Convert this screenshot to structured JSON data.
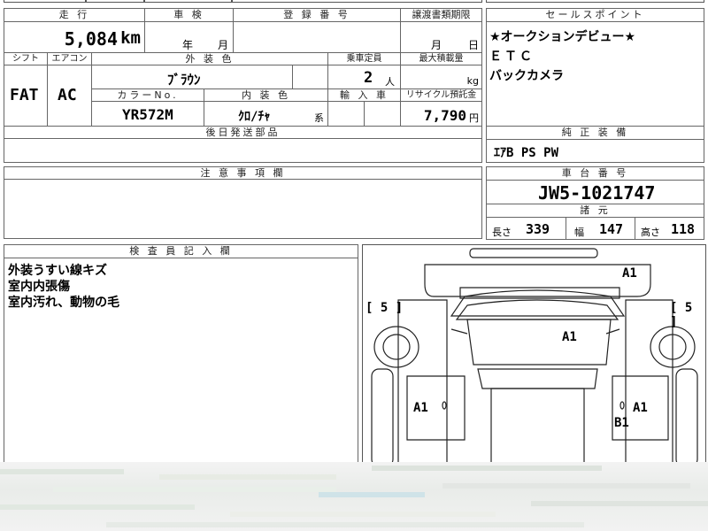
{
  "mileage": {
    "header": "走 行",
    "value": "5,084",
    "unit": "km"
  },
  "inspection": {
    "header": "車 検",
    "year_label": "年",
    "month_label": "月"
  },
  "registration": {
    "header": "登 録 番 号",
    "value": ""
  },
  "transfer_deadline": {
    "header": "譲渡書類期限",
    "month_label": "月",
    "day_label": "日"
  },
  "sales_points": {
    "header": "セールスポイント",
    "items": [
      "★オークションデビュー★",
      "ＥＴＣ",
      "バックカメラ"
    ]
  },
  "shift": {
    "header": "シフト",
    "value": "FAT"
  },
  "aircon": {
    "header": "エアコン",
    "value": "AC"
  },
  "exterior_color": {
    "header": "外 装 色",
    "value": "ﾌﾞﾗｳﾝ"
  },
  "capacity": {
    "header": "乗車定員",
    "value": "2",
    "unit": "人"
  },
  "max_load": {
    "header": "最大積載量",
    "value": "",
    "unit": "kg"
  },
  "color_no": {
    "header": "カラーNo.",
    "value": "YR572M"
  },
  "interior_color": {
    "header": "内 装 色",
    "value": "ｸﾛ/ﾁｬ",
    "suffix": "系"
  },
  "import": {
    "header": "輸 入 車",
    "value": ""
  },
  "recycle_fee": {
    "header": "リサイクル預託金",
    "value": "7,790",
    "unit": "円"
  },
  "later_shipping": {
    "header": "後日発送部品",
    "value": ""
  },
  "factory_equipment": {
    "header": "純 正 装 備",
    "value": "ｴｱB PS PW"
  },
  "notes": {
    "header": "注 意 事 項 欄",
    "value": ""
  },
  "chassis_no": {
    "header": "車 台 番 号",
    "value": "JW5-1021747"
  },
  "dimensions": {
    "header": "諸 元",
    "length_label": "長さ",
    "length": "339",
    "width_label": "幅",
    "width": "147",
    "height_label": "高さ",
    "height": "118"
  },
  "inspector_notes": {
    "header": "検 査 員 記 入 欄",
    "lines": [
      "外装うすい線キズ",
      "室内内張傷",
      "室内汚れ、動物の毛"
    ]
  },
  "diagram": {
    "tire_left": "[ 5 ]",
    "tire_right": "[ 5 ]",
    "marks": [
      "A1",
      "A1",
      "A1",
      "A1",
      "B1"
    ]
  }
}
